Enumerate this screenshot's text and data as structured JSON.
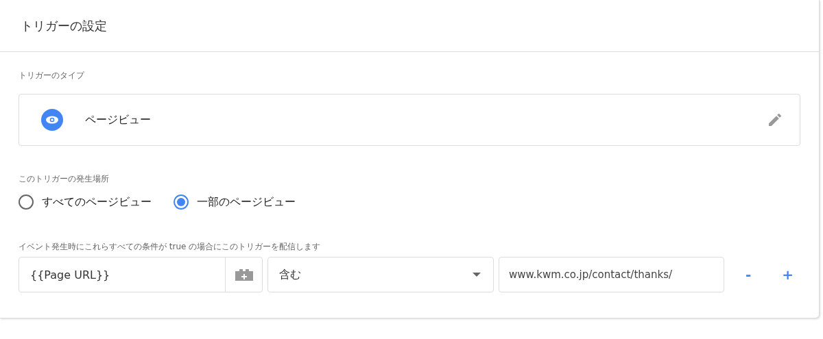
{
  "title": "トリガーの設定",
  "trigger_type": {
    "label": "トリガーのタイプ",
    "value": "ページビュー"
  },
  "occurrence": {
    "label": "このトリガーの発生場所",
    "options": [
      {
        "label": "すべてのページビュー",
        "selected": false
      },
      {
        "label": "一部のページビュー",
        "selected": true
      }
    ]
  },
  "conditions": {
    "label": "イベント発生時にこれらすべての条件が true の場合にこのトリガーを配信します",
    "rows": [
      {
        "variable": "{{Page URL}}",
        "operator": "含む",
        "value": "www.kwm.co.jp/contact/thanks/",
        "remove": "-",
        "add": "+"
      }
    ]
  }
}
